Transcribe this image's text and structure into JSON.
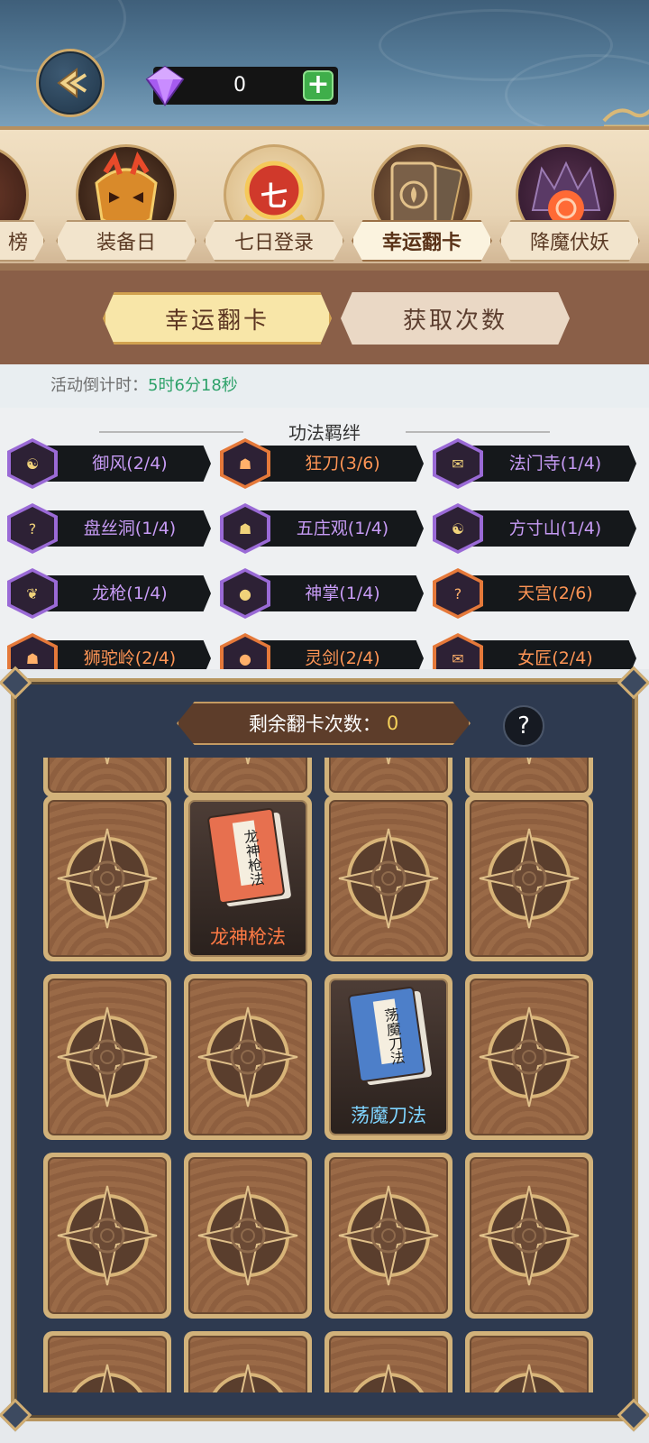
{
  "header": {
    "gem_count": "0",
    "plus_label": "+"
  },
  "event_tabs": [
    {
      "label": "榜",
      "active": false
    },
    {
      "label": "装备日",
      "active": false
    },
    {
      "label": "七日登录",
      "active": false,
      "badge": "七"
    },
    {
      "label": "幸运翻卡",
      "active": true
    },
    {
      "label": "降魔伏妖",
      "active": false
    }
  ],
  "sub_tabs": [
    {
      "label": "幸运翻卡",
      "active": true
    },
    {
      "label": "获取次数",
      "active": false
    }
  ],
  "countdown": {
    "label": "活动倒计时：",
    "time": "5时6分18秒"
  },
  "bonds": {
    "title": "功法羁绊",
    "items": [
      {
        "name": "御风(2/4)",
        "tier": "purple",
        "icon": "yin-yang-icon"
      },
      {
        "name": "狂刀(3/6)",
        "tier": "orange",
        "icon": "mask-icon"
      },
      {
        "name": "法门寺(1/4)",
        "tier": "purple",
        "icon": "scroll-icon"
      },
      {
        "name": "盘丝洞(1/4)",
        "tier": "purple",
        "icon": "question-scroll-icon"
      },
      {
        "name": "五庄观(1/4)",
        "tier": "purple",
        "icon": "mask-icon"
      },
      {
        "name": "方寸山(1/4)",
        "tier": "purple",
        "icon": "yin-yang-icon"
      },
      {
        "name": "龙枪(1/4)",
        "tier": "purple",
        "icon": "dragon-icon"
      },
      {
        "name": "神掌(1/4)",
        "tier": "purple",
        "icon": "orb-icon"
      },
      {
        "name": "天宫(2/6)",
        "tier": "orange",
        "icon": "question-icon"
      },
      {
        "name": "狮驼岭(2/4)",
        "tier": "orange",
        "icon": "mask-icon"
      },
      {
        "name": "灵剑(2/4)",
        "tier": "orange",
        "icon": "orb-icon"
      },
      {
        "name": "女匠(2/4)",
        "tier": "orange",
        "icon": "scroll-icon"
      }
    ]
  },
  "board": {
    "remain_label": "剩余翻卡次数：",
    "remain_count": "0",
    "help_label": "?",
    "revealed": [
      {
        "label": "龙神枪法",
        "color": "#ff7a45",
        "book_color": "#e7704f",
        "book_title": "龙神枪法"
      },
      {
        "label": "荡魔刀法",
        "color": "#7fd4ff",
        "book_color": "#4d7fc9",
        "book_title": "荡魔刀法"
      }
    ]
  },
  "colors": {
    "accent_gold": "#c9a46c",
    "countdown_green": "#2fa26a",
    "purple_tier": "#9a6ad6",
    "orange_tier": "#e5793a"
  }
}
